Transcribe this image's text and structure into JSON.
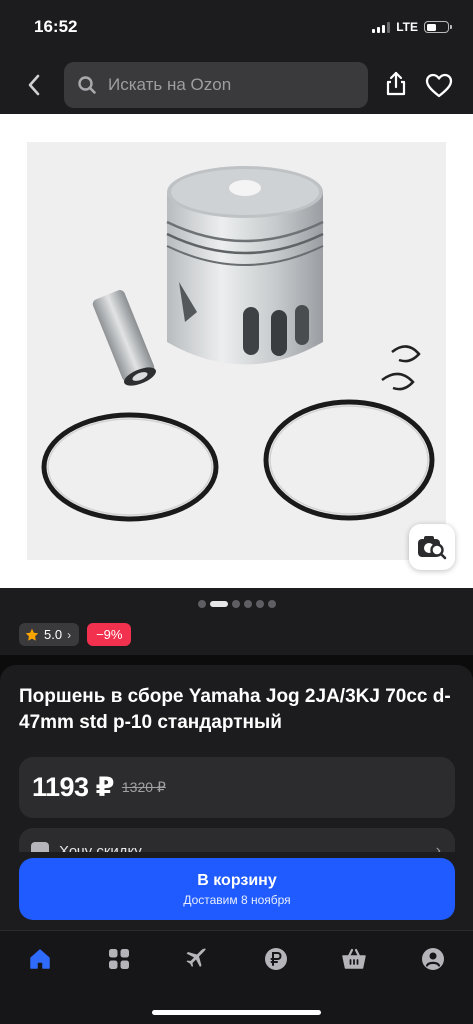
{
  "status_bar": {
    "time": "16:52",
    "network": "LTE"
  },
  "header": {
    "search_placeholder": "Искать на Ozon",
    "icons": [
      "chevron-left-icon",
      "search-icon",
      "share-icon",
      "heart-icon"
    ]
  },
  "gallery": {
    "image_count": 6,
    "active_index": 1,
    "visual_search_icon": "camera-search-icon"
  },
  "badges": {
    "rating": "5.0",
    "discount": "−9%"
  },
  "product": {
    "title": "Поршень в сборе Yamaha Jog 2JA/3KJ 70cc d-47mm std p-10 стандартный",
    "price": "1193 ₽",
    "old_price": "1320 ₽",
    "discount_offer": "Хочу скидку"
  },
  "cart": {
    "label": "В корзину",
    "delivery": "Доставим 8 ноября"
  },
  "tabs": [
    "home-icon",
    "catalog-icon",
    "travel-icon",
    "ruble-icon",
    "cart-icon",
    "profile-icon"
  ],
  "colors": {
    "accent": "#1f5bff",
    "discount": "#f2314f",
    "star": "#ffa500",
    "tab_active": "#2f6bff",
    "tab_inactive": "#b4b4b9"
  }
}
